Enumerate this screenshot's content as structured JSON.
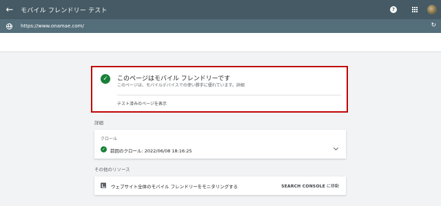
{
  "header": {
    "back_icon": "arrow-left-icon",
    "title": "モバイル フレンドリー テスト",
    "help_icon": "help-icon",
    "help_glyph": "?",
    "apps_icon": "apps-grid-icon",
    "avatar_icon": "user-avatar"
  },
  "url_bar": {
    "globe_icon": "globe-icon",
    "url": "https://www.onamae.com/",
    "reload_icon": "reload-icon"
  },
  "result": {
    "status_icon": "check-circle-icon",
    "title": "このページはモバイル フレンドリーです",
    "description": "このページは、モバイルデバイスでの使い勝手に優れています。",
    "details_link": "詳細",
    "view_tested_page": "テスト済みのページを表示",
    "highlight_color": "#c00000"
  },
  "details": {
    "section_label": "詳細",
    "crawl": {
      "label": "クロール",
      "value": "前回のクロール: 2022/06/08 18:16:25",
      "status_icon": "check-circle-icon",
      "expand_icon": "chevron-down-icon"
    }
  },
  "other_resources": {
    "section_label": "その他のリソース",
    "items": [
      {
        "icon": "chart-icon",
        "text": "ウェブサイト全体のモバイル フレンドリーをモニタリングする",
        "action_strong": "SEARCH CONSOLE",
        "action_suffix": " に移動"
      }
    ]
  },
  "colors": {
    "header_bg": "#455a64",
    "url_bar_bg": "#546e7a",
    "success_green": "#188038",
    "page_bg": "#f1f3f4"
  }
}
